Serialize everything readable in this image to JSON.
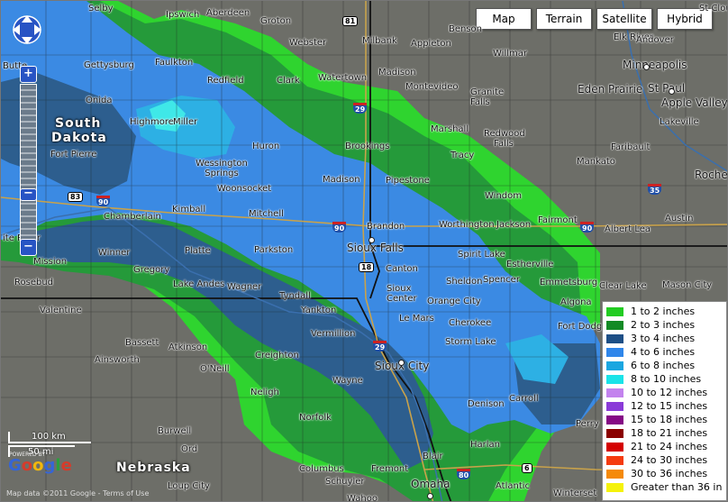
{
  "map_types": [
    "Map",
    "Terrain",
    "Satellite",
    "Hybrid"
  ],
  "colors": {
    "base": "#6d6e68",
    "c1": "#2fd42f",
    "c2": "#259a3a",
    "c3": "#2d5e8e",
    "c4": "#3b8ae3",
    "c6": "#2db0e4",
    "c8": "#3fe8e8"
  },
  "states": [
    {
      "id": "south-dakota-1",
      "text": "South"
    },
    {
      "id": "south-dakota-2",
      "text": "Dakota"
    },
    {
      "id": "nebraska",
      "text": "Nebraska"
    }
  ],
  "cities": [
    {
      "id": "selby",
      "text": "Selby"
    },
    {
      "id": "ipswich",
      "text": "Ipswich"
    },
    {
      "id": "aberdeen",
      "text": "Aberdeen"
    },
    {
      "id": "groton",
      "text": "Groton"
    },
    {
      "id": "webster",
      "text": "Webster"
    },
    {
      "id": "milbank",
      "text": "Milbank"
    },
    {
      "id": "appleton",
      "text": "Appleton"
    },
    {
      "id": "benson",
      "text": "Benson"
    },
    {
      "id": "willmar",
      "text": "Willmar"
    },
    {
      "id": "elk-river",
      "text": "Elk River"
    },
    {
      "id": "andover",
      "text": "Andover"
    },
    {
      "id": "minneapolis",
      "text": "Minneapolis"
    },
    {
      "id": "st-paul",
      "text": "St Paul"
    },
    {
      "id": "eden-prairie",
      "text": "Eden Prairie"
    },
    {
      "id": "apple-valley",
      "text": "Apple Valley"
    },
    {
      "id": "lakeville",
      "text": "Lakeville"
    },
    {
      "id": "st-cloud",
      "text": "St Cloud"
    },
    {
      "id": "butte",
      "text": "Butte"
    },
    {
      "id": "gettysburg",
      "text": "Gettysburg"
    },
    {
      "id": "faulkton",
      "text": "Faulkton"
    },
    {
      "id": "redfield",
      "text": "Redfield"
    },
    {
      "id": "clark",
      "text": "Clark"
    },
    {
      "id": "watertown",
      "text": "Watertown"
    },
    {
      "id": "madison-mn",
      "text": "Madison"
    },
    {
      "id": "montevideo",
      "text": "Montevideo"
    },
    {
      "id": "granite-falls",
      "text": "Granite Falls"
    },
    {
      "id": "onida",
      "text": "Onida"
    },
    {
      "id": "highmore",
      "text": "Highmore"
    },
    {
      "id": "miller",
      "text": "Miller"
    },
    {
      "id": "huron",
      "text": "Huron"
    },
    {
      "id": "marshall",
      "text": "Marshall"
    },
    {
      "id": "redwood-falls",
      "text": "Redwood Falls"
    },
    {
      "id": "fort-pierre",
      "text": "Fort Pierre"
    },
    {
      "id": "brookings",
      "text": "Brookings"
    },
    {
      "id": "tracy",
      "text": "Tracy"
    },
    {
      "id": "faribault",
      "text": "Faribault"
    },
    {
      "id": "wessington-springs",
      "text": "Wessington Springs"
    },
    {
      "id": "woonsocket",
      "text": "Woonsocket"
    },
    {
      "id": "madison-sd",
      "text": "Madison"
    },
    {
      "id": "pipestone",
      "text": "Pipestone"
    },
    {
      "id": "mankato",
      "text": "Mankato"
    },
    {
      "id": "rochester",
      "text": "Roche"
    },
    {
      "id": "windom",
      "text": "Windom"
    },
    {
      "id": "chamberlain",
      "text": "Chamberlain"
    },
    {
      "id": "kimball",
      "text": "Kimball"
    },
    {
      "id": "mitchell",
      "text": "Mitchell"
    },
    {
      "id": "brandon",
      "text": "Brandon"
    },
    {
      "id": "worthington",
      "text": "Worthington"
    },
    {
      "id": "jackson",
      "text": "Jackson"
    },
    {
      "id": "fairmont",
      "text": "Fairmont"
    },
    {
      "id": "albert-lea",
      "text": "Albert Lea"
    },
    {
      "id": "austin",
      "text": "Austin"
    },
    {
      "id": "white-river",
      "text": "ite River"
    },
    {
      "id": "winner",
      "text": "Winner"
    },
    {
      "id": "platte",
      "text": "Platte"
    },
    {
      "id": "parkston",
      "text": "Parkston"
    },
    {
      "id": "sioux-falls",
      "text": "Sioux Falls"
    },
    {
      "id": "spirit-lake",
      "text": "Spirit Lake"
    },
    {
      "id": "estherville",
      "text": "Estherville"
    },
    {
      "id": "mission",
      "text": "Mission"
    },
    {
      "id": "gregory",
      "text": "Gregory"
    },
    {
      "id": "canton",
      "text": "Canton"
    },
    {
      "id": "emmetsburg",
      "text": "Emmetsburg"
    },
    {
      "id": "rosebud",
      "text": "Rosebud"
    },
    {
      "id": "lake-andes",
      "text": "Lake Andes"
    },
    {
      "id": "wagner",
      "text": "Wagner"
    },
    {
      "id": "sheldon",
      "text": "Sheldon"
    },
    {
      "id": "spencer",
      "text": "Spencer"
    },
    {
      "id": "algona",
      "text": "Algona"
    },
    {
      "id": "clear-lake",
      "text": "Clear Lake"
    },
    {
      "id": "mason-city",
      "text": "Mason City"
    },
    {
      "id": "tyndall",
      "text": "Tyndall"
    },
    {
      "id": "sioux-center-1",
      "text": "Sioux"
    },
    {
      "id": "sioux-center-2",
      "text": "Center"
    },
    {
      "id": "orange-city",
      "text": "Orange City"
    },
    {
      "id": "valentine",
      "text": "Valentine"
    },
    {
      "id": "yankton",
      "text": "Yankton"
    },
    {
      "id": "le-mars",
      "text": "Le Mars"
    },
    {
      "id": "cherokee",
      "text": "Cherokee"
    },
    {
      "id": "vermillion",
      "text": "Vermillion"
    },
    {
      "id": "storm-lake",
      "text": "Storm Lake"
    },
    {
      "id": "fort-dodge",
      "text": "Fort Dodge"
    },
    {
      "id": "bassett",
      "text": "Bassett"
    },
    {
      "id": "atkinson",
      "text": "Atkinson"
    },
    {
      "id": "creighton",
      "text": "Creighton"
    },
    {
      "id": "ainsworth",
      "text": "Ainsworth"
    },
    {
      "id": "oneill",
      "text": "O'Neill"
    },
    {
      "id": "sioux-city",
      "text": "Sioux City"
    },
    {
      "id": "wayne",
      "text": "Wayne"
    },
    {
      "id": "nelighe",
      "text": "Neligh"
    },
    {
      "id": "denison",
      "text": "Denison"
    },
    {
      "id": "carroll",
      "text": "Carroll"
    },
    {
      "id": "norfolk",
      "text": "Norfolk"
    },
    {
      "id": "perry",
      "text": "Perry"
    },
    {
      "id": "burwell",
      "text": "Burwell"
    },
    {
      "id": "ord",
      "text": "Ord"
    },
    {
      "id": "blair",
      "text": "Blair"
    },
    {
      "id": "harlan",
      "text": "Harlan"
    },
    {
      "id": "columbus",
      "text": "Columbus"
    },
    {
      "id": "fremont",
      "text": "Fremont"
    },
    {
      "id": "loup-city",
      "text": "Loup City"
    },
    {
      "id": "schuyler",
      "text": "Schuyler"
    },
    {
      "id": "omaha",
      "text": "Omaha"
    },
    {
      "id": "atlantic",
      "text": "Atlantic"
    },
    {
      "id": "winterset",
      "text": "Winterset"
    },
    {
      "id": "wahoo",
      "text": "Wahoo"
    }
  ],
  "shields": [
    {
      "id": "i29-north",
      "text": "29"
    },
    {
      "id": "i29-south",
      "text": "29"
    },
    {
      "id": "i90-west",
      "text": "90"
    },
    {
      "id": "i90-east",
      "text": "90"
    },
    {
      "id": "i90-far-east",
      "text": "90"
    },
    {
      "id": "i35",
      "text": "35"
    },
    {
      "id": "i80",
      "text": "80"
    },
    {
      "id": "us81",
      "text": "81"
    },
    {
      "id": "us83",
      "text": "83"
    },
    {
      "id": "us18",
      "text": "18"
    },
    {
      "id": "us6",
      "text": "6"
    }
  ],
  "legend": {
    "items": [
      {
        "label": "1 to 2 inches",
        "color": "#22cc22"
      },
      {
        "label": "2 to 3 inches",
        "color": "#138a25"
      },
      {
        "label": "3 to 4 inches",
        "color": "#1d4f86"
      },
      {
        "label": "4 to 6 inches",
        "color": "#2f86ea"
      },
      {
        "label": "6 to 8 inches",
        "color": "#1aa6e0"
      },
      {
        "label": "8 to 10 inches",
        "color": "#1ae3e8"
      },
      {
        "label": "10 to 12 inches",
        "color": "#c383ee"
      },
      {
        "label": "12 to 15 inches",
        "color": "#8a3ad8"
      },
      {
        "label": "15 to 18 inches",
        "color": "#850a85"
      },
      {
        "label": "18 to 21 inches",
        "color": "#8a0000"
      },
      {
        "label": "21 to 24 inches",
        "color": "#d40000"
      },
      {
        "label": "24 to 30 inches",
        "color": "#f53b0f"
      },
      {
        "label": "30 to 36 inches",
        "color": "#f58a0a"
      },
      {
        "label": "Greater than 36 in",
        "color": "#f5f20a"
      }
    ]
  },
  "scale": {
    "km": "100 km",
    "mi": "50 mi"
  },
  "attribution": {
    "powered": "POWERED BY",
    "logo": "Google",
    "copyright": "Map data ©2011 Google - Terms of Use"
  }
}
